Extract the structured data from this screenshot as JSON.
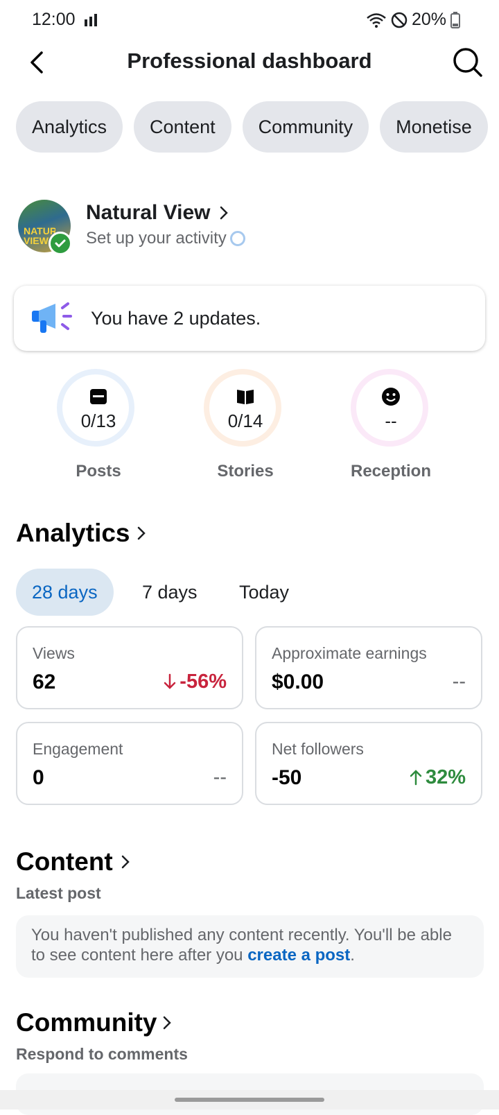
{
  "status_bar": {
    "time": "12:00",
    "battery": "20%"
  },
  "header": {
    "title": "Professional dashboard"
  },
  "tabs": [
    "Analytics",
    "Content",
    "Community",
    "Monetise"
  ],
  "profile": {
    "name": "Natural View",
    "subtitle": "Set up your activity",
    "avatar_text": "NATURAL VIEW"
  },
  "updates": {
    "text": "You have 2 updates."
  },
  "stats": [
    {
      "value": "0/13",
      "label": "Posts",
      "icon": "post-icon",
      "ring_color": "#e7f0fb"
    },
    {
      "value": "0/14",
      "label": "Stories",
      "icon": "book-icon",
      "ring_color": "#fdeee2"
    },
    {
      "value": "--",
      "label": "Reception",
      "icon": "smiley-icon",
      "ring_color": "#fbe9f8"
    }
  ],
  "analytics": {
    "title": "Analytics",
    "periods": [
      "28 days",
      "7 days",
      "Today"
    ],
    "active_period": "28 days",
    "cards": [
      {
        "label": "Views",
        "value": "62",
        "delta": "-56%",
        "trend": "down"
      },
      {
        "label": "Approximate earnings",
        "value": "$0.00",
        "delta": "--",
        "trend": "none"
      },
      {
        "label": "Engagement",
        "value": "0",
        "delta": "--",
        "trend": "none"
      },
      {
        "label": "Net followers",
        "value": "-50",
        "delta": "32%",
        "trend": "up"
      }
    ]
  },
  "content": {
    "title": "Content",
    "subtitle": "Latest post",
    "empty_text": "You haven't published any content recently. You'll be able to see content here after you ",
    "link_text": "create a post",
    "end_text": "."
  },
  "community": {
    "title": "Community",
    "subtitle": "Respond to comments"
  },
  "colors": {
    "accent": "#0a66c2",
    "negative": "#c8243d",
    "positive": "#2e8b3e",
    "chip_bg": "#e4e6eb"
  }
}
